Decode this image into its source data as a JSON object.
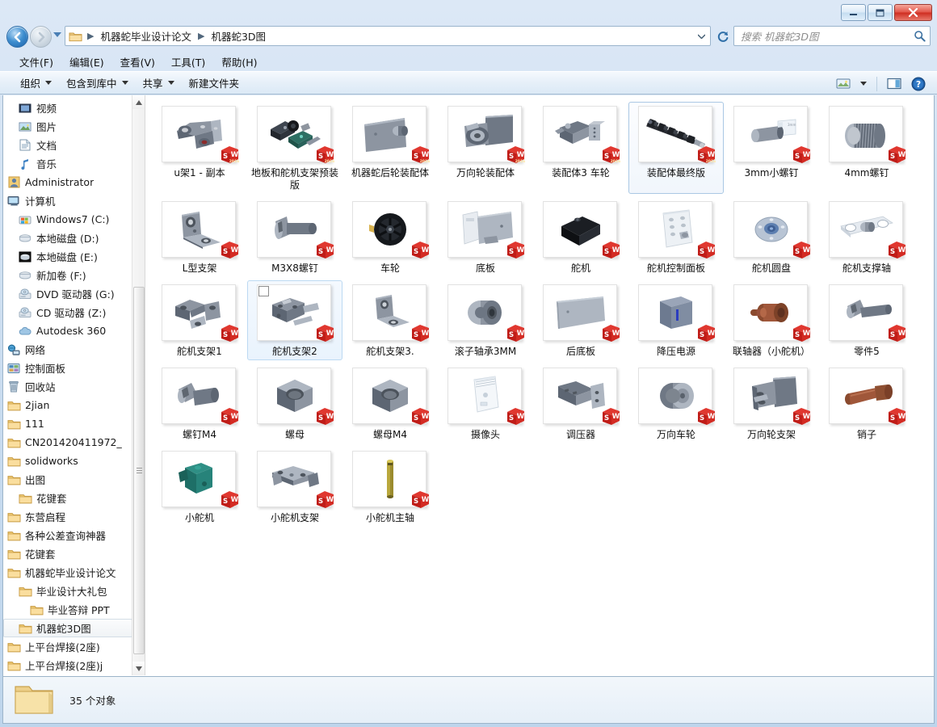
{
  "window": {
    "controls": {
      "minimize": "minimize-button",
      "maximize": "maximize-button",
      "close": "close-button"
    }
  },
  "address": {
    "back_label": "后退",
    "forward_label": "前进",
    "recent_label": "最近访问的位置",
    "crumbs": [
      "机器蛇毕业设计论文",
      "机器蛇3D图"
    ],
    "refresh_label": "刷新"
  },
  "search": {
    "placeholder": "搜索 机器蛇3D图",
    "value": ""
  },
  "menubar": {
    "items": [
      {
        "label": "文件(F)"
      },
      {
        "label": "编辑(E)"
      },
      {
        "label": "查看(V)"
      },
      {
        "label": "工具(T)"
      },
      {
        "label": "帮助(H)"
      }
    ]
  },
  "toolbar": {
    "organize": "组织",
    "include_library": "包含到库中",
    "share": "共享",
    "new_folder": "新建文件夹",
    "view_label": "更改您的视图",
    "preview_label": "显示预览窗格",
    "help_label": "获取帮助"
  },
  "sidebar": {
    "items": [
      {
        "label": "视频",
        "icon": "video-icon",
        "indent": 1
      },
      {
        "label": "图片",
        "icon": "pictures-icon",
        "indent": 1
      },
      {
        "label": "文档",
        "icon": "documents-icon",
        "indent": 1
      },
      {
        "label": "音乐",
        "icon": "music-icon",
        "indent": 1
      },
      {
        "label": "Administrator",
        "icon": "user-icon",
        "indent": 0
      },
      {
        "label": "计算机",
        "icon": "computer-icon",
        "indent": 0
      },
      {
        "label": "Windows7 (C:)",
        "icon": "windows-drive-icon",
        "indent": 1
      },
      {
        "label": "本地磁盘 (D:)",
        "icon": "drive-icon",
        "indent": 1
      },
      {
        "label": "本地磁盘 (E:)",
        "icon": "drive-dark-icon",
        "indent": 1
      },
      {
        "label": "新加卷 (F:)",
        "icon": "drive-icon",
        "indent": 1
      },
      {
        "label": "DVD 驱动器 (G:)",
        "icon": "dvd-drive-icon",
        "indent": 1
      },
      {
        "label": "CD 驱动器 (Z:)",
        "icon": "cd-drive-icon",
        "indent": 1
      },
      {
        "label": "Autodesk 360",
        "icon": "cloud-icon",
        "indent": 1
      },
      {
        "label": "网络",
        "icon": "network-icon",
        "indent": 0
      },
      {
        "label": "控制面板",
        "icon": "control-panel-icon",
        "indent": 0
      },
      {
        "label": "回收站",
        "icon": "recycle-bin-icon",
        "indent": 0
      },
      {
        "label": "2jian",
        "icon": "folder-icon",
        "indent": 0
      },
      {
        "label": "111",
        "icon": "folder-icon",
        "indent": 0
      },
      {
        "label": "CN201420411972_",
        "icon": "folder-icon",
        "indent": 0
      },
      {
        "label": "solidworks",
        "icon": "folder-icon",
        "indent": 0
      },
      {
        "label": "出图",
        "icon": "folder-icon",
        "indent": 0
      },
      {
        "label": "花键套",
        "icon": "folder-icon",
        "indent": 1
      },
      {
        "label": "东营启程",
        "icon": "folder-icon",
        "indent": 0
      },
      {
        "label": "各种公差查询神器",
        "icon": "folder-icon",
        "indent": 0
      },
      {
        "label": "花键套",
        "icon": "folder-icon",
        "indent": 0
      },
      {
        "label": "机器蛇毕业设计论文",
        "icon": "folder-icon",
        "indent": 0
      },
      {
        "label": "毕业设计大礼包",
        "icon": "folder-icon",
        "indent": 1
      },
      {
        "label": "毕业答辩  PPT  ",
        "icon": "folder-icon",
        "indent": 2
      },
      {
        "label": "机器蛇3D图",
        "icon": "folder-icon",
        "indent": 1,
        "selected": true
      },
      {
        "label": "上平台焊接(2座)",
        "icon": "folder-icon",
        "indent": 0
      },
      {
        "label": "上平台焊接(2座)j",
        "icon": "folder-icon",
        "indent": 0
      }
    ]
  },
  "files": {
    "items": [
      {
        "name": "u架1 - 副本",
        "thumb": "u-bracket",
        "badge": "sw2016"
      },
      {
        "name": "地板和舵机支架预装版",
        "thumb": "assembly-servo-floor",
        "badge": "sw2016"
      },
      {
        "name": "机器蛇后轮装配体",
        "thumb": "plate-with-boss",
        "badge": "sw2016"
      },
      {
        "name": "万向轮装配体",
        "thumb": "caster-assembly",
        "badge": "sw2016"
      },
      {
        "name": "装配体3 车轮",
        "thumb": "servo-wheel-assembly",
        "badge": "sw2016"
      },
      {
        "name": "装配体最终版",
        "thumb": "snake-robot-full",
        "badge": "sw2016",
        "selected": true
      },
      {
        "name": "3mm小螺钉",
        "thumb": "small-screw",
        "badge": "sw"
      },
      {
        "name": "4mm螺钉",
        "thumb": "threaded-screw",
        "badge": "sw"
      },
      {
        "name": "L型支架",
        "thumb": "l-bracket",
        "badge": "sw"
      },
      {
        "name": "M3X8螺钉",
        "thumb": "pan-screw",
        "badge": "sw"
      },
      {
        "name": "车轮",
        "thumb": "wheel-black",
        "badge": "sw"
      },
      {
        "name": "底板",
        "thumb": "base-plate",
        "badge": "sw"
      },
      {
        "name": "舵机",
        "thumb": "servo-black",
        "badge": "sw"
      },
      {
        "name": "舵机控制面板",
        "thumb": "control-panel",
        "badge": "sw"
      },
      {
        "name": "舵机圆盘",
        "thumb": "servo-disc",
        "badge": "sw"
      },
      {
        "name": "舵机支撑轴",
        "thumb": "support-shaft",
        "badge": "sw"
      },
      {
        "name": "舵机支架1",
        "thumb": "servo-bracket-1",
        "badge": "sw"
      },
      {
        "name": "舵机支架2",
        "thumb": "servo-bracket-2",
        "badge": "sw",
        "hovered": true
      },
      {
        "name": "舵机支架3.",
        "thumb": "servo-bracket-3",
        "badge": "sw"
      },
      {
        "name": "滚子轴承3MM",
        "thumb": "roller-bearing",
        "badge": "sw"
      },
      {
        "name": "后底板",
        "thumb": "rear-plate",
        "badge": "sw"
      },
      {
        "name": "降压电源",
        "thumb": "power-module",
        "badge": "sw"
      },
      {
        "name": "联轴器（小舵机）",
        "thumb": "coupler-brown",
        "badge": "sw"
      },
      {
        "name": "零件5",
        "thumb": "part5-screw",
        "badge": "sw"
      },
      {
        "name": "螺钉M4",
        "thumb": "screw-m4",
        "badge": "sw"
      },
      {
        "name": "螺母",
        "thumb": "nut",
        "badge": "sw"
      },
      {
        "name": "螺母M4",
        "thumb": "nut-m4",
        "badge": "sw"
      },
      {
        "name": "摄像头",
        "thumb": "camera",
        "badge": "sw"
      },
      {
        "name": "调压器",
        "thumb": "regulator",
        "badge": "sw"
      },
      {
        "name": "万向车轮",
        "thumb": "caster-wheel",
        "badge": "sw"
      },
      {
        "name": "万向轮支架",
        "thumb": "caster-bracket",
        "badge": "sw"
      },
      {
        "name": "销子",
        "thumb": "pin-brown",
        "badge": "sw"
      },
      {
        "name": "小舵机",
        "thumb": "mini-servo-teal",
        "badge": "sw"
      },
      {
        "name": "小舵机支架",
        "thumb": "mini-servo-bracket",
        "badge": "sw"
      },
      {
        "name": "小舵机主轴",
        "thumb": "mini-servo-shaft",
        "badge": "sw"
      }
    ]
  },
  "statusbar": {
    "count_text": "35 个对象"
  },
  "colors": {
    "accent": "#2b6ca8",
    "selection_border": "#aac8e4",
    "close_red": "#cf2d20",
    "folder_yellow": "#f0cc76",
    "sw_red": "#cf1f26"
  }
}
